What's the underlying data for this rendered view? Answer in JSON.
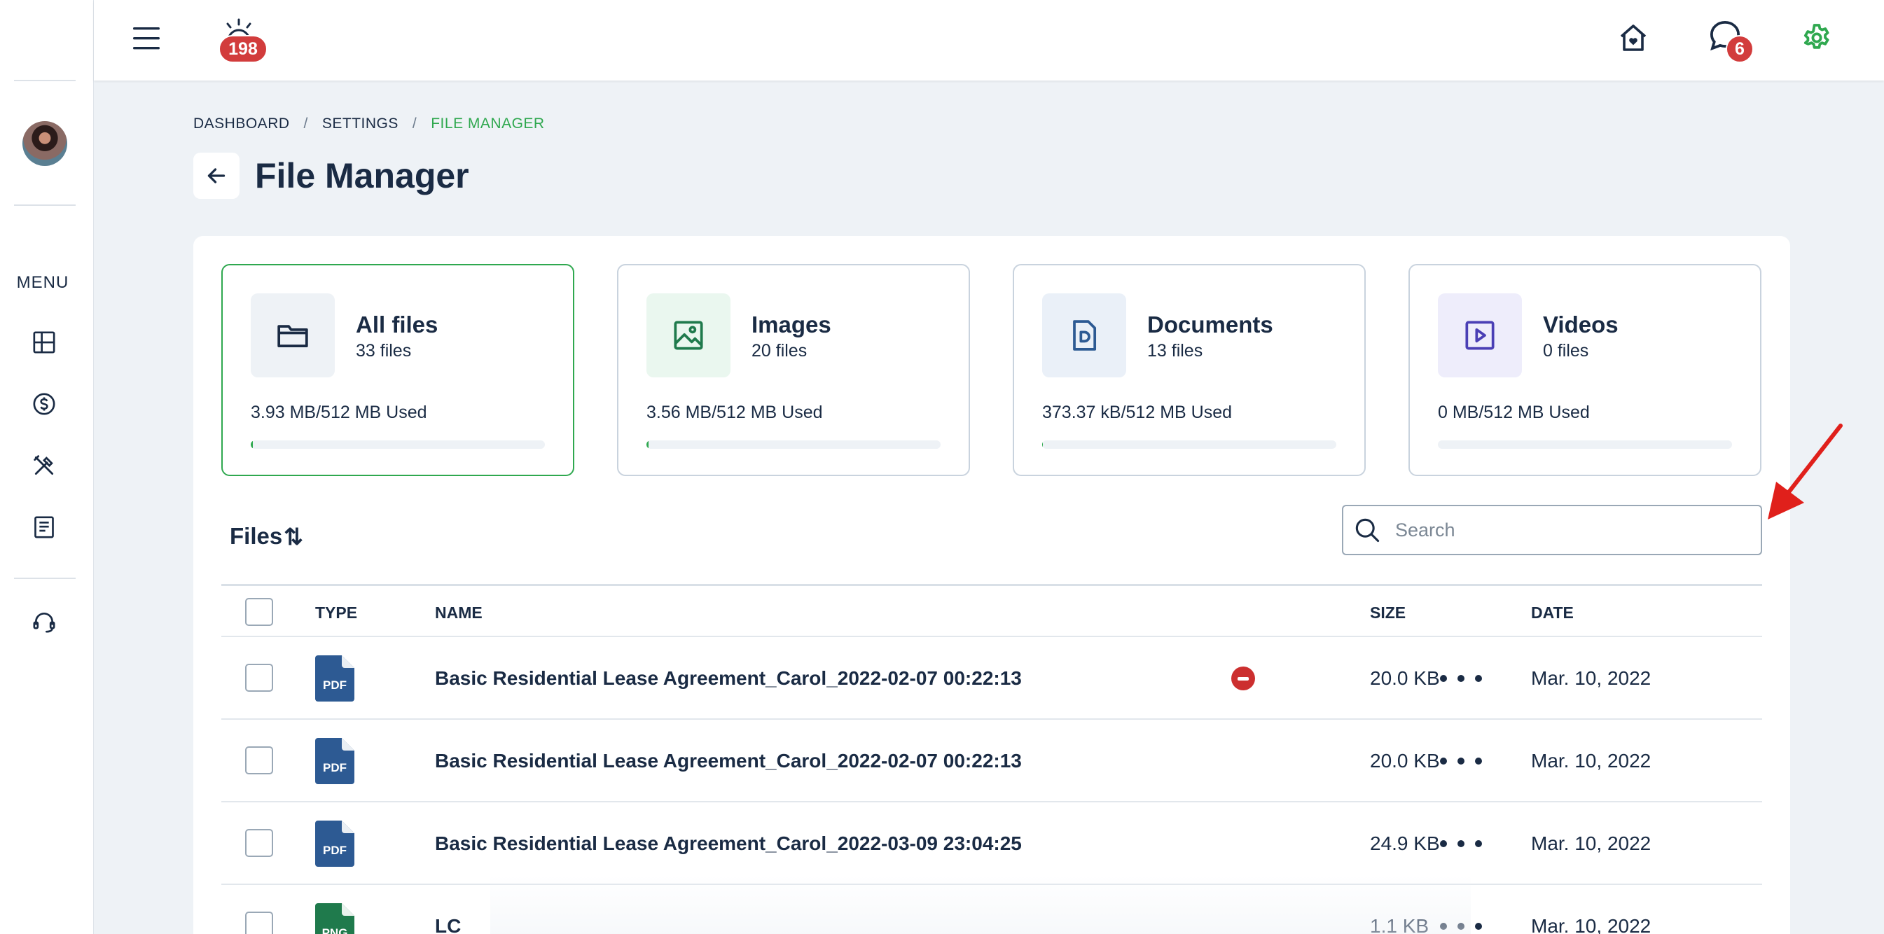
{
  "topbar": {
    "notifications_count": "198",
    "messages_count": "6"
  },
  "sidebar": {
    "menu_label": "MENU",
    "items": [
      {
        "icon": "dashboard-icon"
      },
      {
        "icon": "billing-icon"
      },
      {
        "icon": "tools-icon"
      },
      {
        "icon": "documents-icon"
      },
      {
        "icon": "support-icon"
      }
    ]
  },
  "breadcrumb": {
    "items": [
      "DASHBOARD",
      "SETTINGS",
      "FILE MANAGER"
    ],
    "separator": "/"
  },
  "page": {
    "title": "File Manager"
  },
  "categories": [
    {
      "name": "All files",
      "count": "33 files",
      "used": "3.93 MB/512 MB Used",
      "usage_fraction": 0.0077,
      "icon": "folder-icon",
      "color": "#1a2b44",
      "bg": "#eef2f6",
      "active": true
    },
    {
      "name": "Images",
      "count": "20 files",
      "used": "3.56 MB/512 MB Used",
      "usage_fraction": 0.007,
      "icon": "image-icon",
      "color": "#1f7a4c",
      "bg": "#eaf7ef",
      "active": false
    },
    {
      "name": "Documents",
      "count": "13 files",
      "used": "373.37 kB/512 MB Used",
      "usage_fraction": 0.0007,
      "icon": "document-icon",
      "color": "#2d5a93",
      "bg": "#eaf0f8",
      "active": false
    },
    {
      "name": "Videos",
      "count": "0 files",
      "used": "0 MB/512 MB Used",
      "usage_fraction": 0,
      "icon": "video-icon",
      "color": "#4a3fb5",
      "bg": "#eeedfb",
      "active": false
    }
  ],
  "files": {
    "heading": "Files",
    "sort_glyph": "⇅",
    "search_placeholder": "Search",
    "columns": {
      "type": "TYPE",
      "name": "NAME",
      "size": "SIZE",
      "date": "DATE"
    },
    "rows": [
      {
        "type": "PDF",
        "name": "Basic Residential Lease Agreement_Carol_2022-02-07 00:22:13",
        "size": "20.0 KB",
        "date": "Mar. 10, 2022",
        "blocked": true
      },
      {
        "type": "PDF",
        "name": "Basic Residential Lease Agreement_Carol_2022-02-07 00:22:13",
        "size": "20.0 KB",
        "date": "Mar. 10, 2022",
        "blocked": false
      },
      {
        "type": "PDF",
        "name": "Basic Residential Lease Agreement_Carol_2022-03-09 23:04:25",
        "size": "24.9 KB",
        "date": "Mar. 10, 2022",
        "blocked": false
      },
      {
        "type": "PNG",
        "name": "LC",
        "size": "1.1 KB",
        "date": "Mar. 10, 2022",
        "blocked": false
      }
    ]
  },
  "colors": {
    "accent": "#2fa84f",
    "pdf": "#2d5a93",
    "png": "#1f7a4c",
    "danger": "#d23c3c",
    "annotation_arrow": "#e0201b"
  }
}
